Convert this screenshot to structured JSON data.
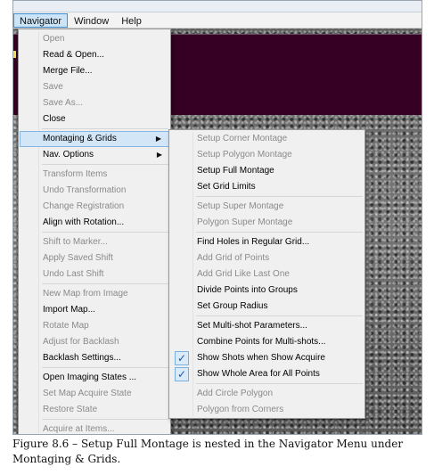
{
  "menubar": {
    "items": [
      "Navigator",
      "Window",
      "Help"
    ]
  },
  "navigator_menu": {
    "groups": [
      [
        {
          "label": "Open",
          "enabled": false
        },
        {
          "label": "Read & Open...",
          "enabled": true
        },
        {
          "label": "Merge File...",
          "enabled": true
        },
        {
          "label": "Save",
          "enabled": false
        },
        {
          "label": "Save As...",
          "enabled": false
        },
        {
          "label": "Close",
          "enabled": true
        }
      ],
      [
        {
          "label": "Montaging & Grids",
          "enabled": true,
          "submenu": true,
          "highlighted": true
        },
        {
          "label": "Nav. Options",
          "enabled": true,
          "submenu": true
        }
      ],
      [
        {
          "label": "Transform Items",
          "enabled": false
        },
        {
          "label": "Undo Transformation",
          "enabled": false
        },
        {
          "label": "Change Registration",
          "enabled": false
        },
        {
          "label": "Align with Rotation...",
          "enabled": true
        }
      ],
      [
        {
          "label": "Shift to Marker...",
          "enabled": false
        },
        {
          "label": "Apply Saved Shift",
          "enabled": false
        },
        {
          "label": "Undo Last Shift",
          "enabled": false
        }
      ],
      [
        {
          "label": "New Map from Image",
          "enabled": false
        },
        {
          "label": "Import Map...",
          "enabled": true
        },
        {
          "label": "Rotate Map",
          "enabled": false
        },
        {
          "label": "Adjust for Backlash",
          "enabled": false
        },
        {
          "label": "Backlash Settings...",
          "enabled": true
        }
      ],
      [
        {
          "label": "Open Imaging States ...",
          "enabled": true
        },
        {
          "label": "Set Map Acquire State",
          "enabled": false
        },
        {
          "label": "Restore State",
          "enabled": false
        }
      ],
      [
        {
          "label": "Acquire at Items...",
          "enabled": false
        }
      ]
    ]
  },
  "montage_submenu": {
    "groups": [
      [
        {
          "label": "Setup Corner Montage",
          "enabled": false
        },
        {
          "label": "Setup Polygon Montage",
          "enabled": false
        },
        {
          "label": "Setup Full Montage",
          "enabled": true
        },
        {
          "label": "Set Grid Limits",
          "enabled": true
        }
      ],
      [
        {
          "label": "Setup Super Montage",
          "enabled": false
        },
        {
          "label": "Polygon Super Montage",
          "enabled": false
        }
      ],
      [
        {
          "label": "Find Holes in Regular Grid...",
          "enabled": true
        },
        {
          "label": "Add Grid of Points",
          "enabled": false
        },
        {
          "label": "Add Grid Like Last One",
          "enabled": false
        },
        {
          "label": "Divide Points into Groups",
          "enabled": true
        },
        {
          "label": "Set Group Radius",
          "enabled": true
        }
      ],
      [
        {
          "label": "Set Multi-shot Parameters...",
          "enabled": true
        },
        {
          "label": "Combine Points for Multi-shots...",
          "enabled": true
        },
        {
          "label": "Show Shots when Show Acquire",
          "enabled": true,
          "checked": true
        },
        {
          "label": "Show Whole Area for All Points",
          "enabled": true,
          "checked": true
        }
      ],
      [
        {
          "label": "Add Circle Polygon",
          "enabled": false
        },
        {
          "label": "Polygon from Corners",
          "enabled": false
        }
      ]
    ]
  },
  "icons": {
    "submenu_arrow": "chevron-right-icon",
    "check": "checkmark-icon"
  },
  "colors": {
    "highlight": "#d3e6f8",
    "disabled_text": "#8a8a8a",
    "background_panel": "#350023"
  },
  "caption": "Figure 8.6 – Setup Full Montage is nested in the Navigator Menu under Montaging & Grids."
}
